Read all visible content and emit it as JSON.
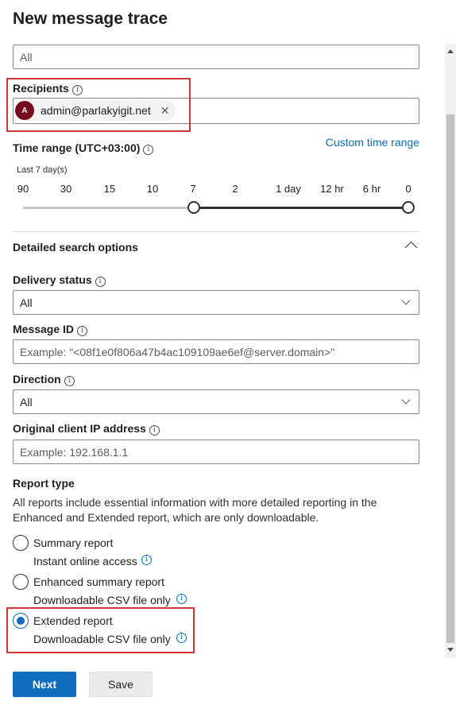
{
  "page": {
    "title": "New message trace"
  },
  "senders": {
    "value": "All"
  },
  "recipients": {
    "label": "Recipients",
    "chip": {
      "initial": "A",
      "email": "admin@parlakyigit.net",
      "close": "✕"
    }
  },
  "time_range": {
    "label": "Time range (UTC+03:00)",
    "custom_link": "Custom time range",
    "sublabel": "Last 7 day(s)",
    "ticks": [
      "90",
      "30",
      "15",
      "10",
      "7",
      "2",
      "1 day",
      "12 hr",
      "6 hr",
      "0"
    ],
    "selected_start": "7",
    "selected_end": "0"
  },
  "detailed": {
    "title": "Detailed search options",
    "expanded": true
  },
  "delivery_status": {
    "label": "Delivery status",
    "value": "All"
  },
  "message_id": {
    "label": "Message ID",
    "placeholder": "Example: \"<08f1e0f806a47b4ac109109ae6ef@server.domain>\""
  },
  "direction": {
    "label": "Direction",
    "value": "All"
  },
  "client_ip": {
    "label": "Original client IP address",
    "placeholder": "Example: 192.168.1.1"
  },
  "report_type": {
    "label": "Report type",
    "description_line1": "All reports include essential information with more detailed reporting in the",
    "description_line2": "Enhanced and Extended report, which are only downloadable.",
    "options": [
      {
        "label": "Summary report",
        "sub": "Instant online access",
        "checked": false
      },
      {
        "label": "Enhanced summary report",
        "sub": "Downloadable CSV file only",
        "checked": false
      },
      {
        "label": "Extended report",
        "sub": "Downloadable CSV file only",
        "checked": true
      }
    ]
  },
  "footer": {
    "next": "Next",
    "save": "Save"
  },
  "colors": {
    "accent": "#0f6cbd",
    "highlight": "#d13438",
    "avatar": "#750b1c"
  }
}
